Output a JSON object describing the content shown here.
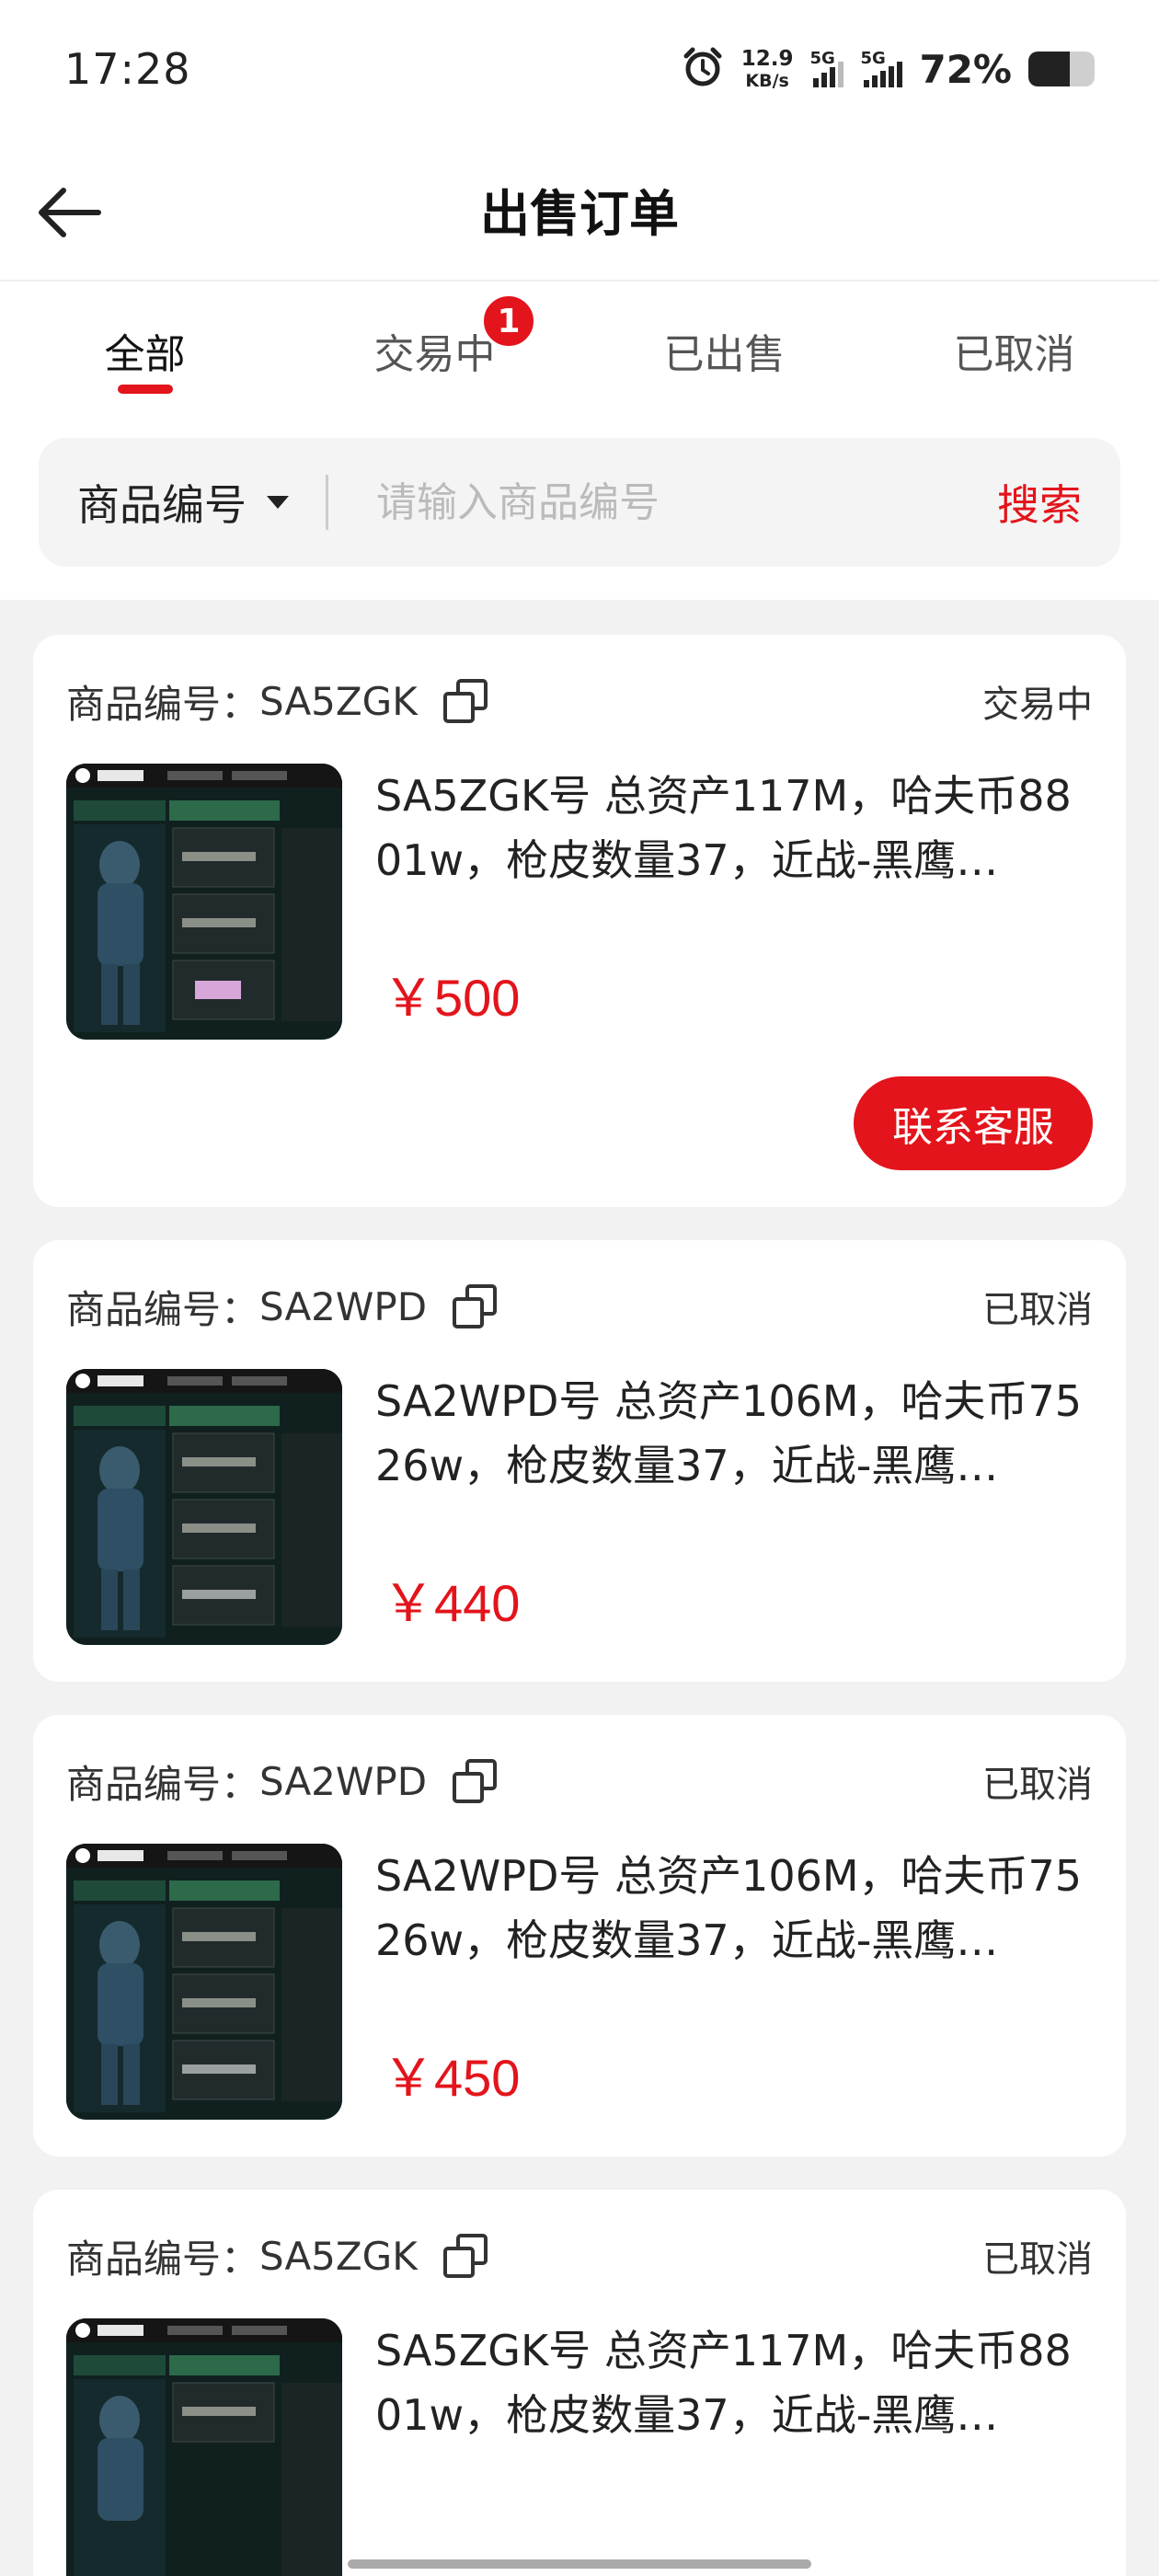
{
  "status_bar": {
    "time": "17:28",
    "net_speed_value": "12.9",
    "net_speed_unit": "KB/s",
    "sim1": "5G",
    "sim2": "5G",
    "battery_percent": "72%",
    "battery_level": 0.72
  },
  "header": {
    "title": "出售订单"
  },
  "tabs": [
    {
      "label": "全部",
      "active": true
    },
    {
      "label": "交易中",
      "badge": "1"
    },
    {
      "label": "已出售"
    },
    {
      "label": "已取消"
    }
  ],
  "search": {
    "type_label": "商品编号",
    "placeholder": "请输入商品编号",
    "button_label": "搜索"
  },
  "orders": [
    {
      "sn_label": "商品编号：",
      "sn": "SA5ZGK",
      "status": "交易中",
      "title": "SA5ZGK号 总资产117M，哈夫币8801w，枪皮数量37，近战-黑鹰…",
      "price": "￥500",
      "action_label": "联系客服"
    },
    {
      "sn_label": "商品编号：",
      "sn": "SA2WPD",
      "status": "已取消",
      "title": "SA2WPD号 总资产106M，哈夫币7526w，枪皮数量37，近战-黑鹰…",
      "price": "￥440"
    },
    {
      "sn_label": "商品编号：",
      "sn": "SA2WPD",
      "status": "已取消",
      "title": "SA2WPD号 总资产106M，哈夫币7526w，枪皮数量37，近战-黑鹰…",
      "price": "￥450"
    },
    {
      "sn_label": "商品编号：",
      "sn": "SA5ZGK",
      "status": "已取消",
      "title": "SA5ZGK号 总资产117M，哈夫币8801w，枪皮数量37，近战-黑鹰…",
      "price": ""
    }
  ],
  "colors": {
    "accent": "#e3141b",
    "background": "#f2f2f2"
  }
}
